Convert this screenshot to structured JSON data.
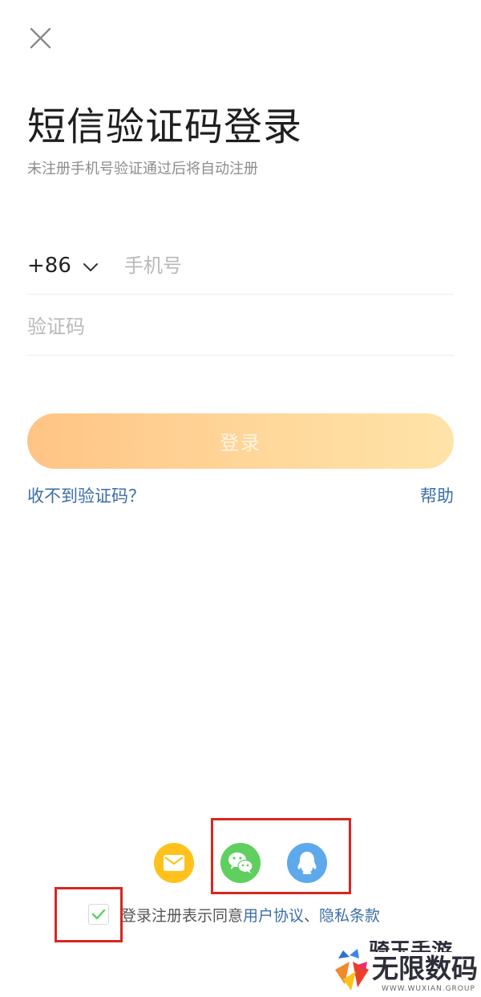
{
  "header": {
    "close_icon": "close-icon",
    "title": "短信验证码登录",
    "subtitle": "未注册手机号验证通过后将自动注册"
  },
  "form": {
    "country_code": "+86",
    "phone_placeholder": "手机号",
    "code_placeholder": "验证码",
    "login_label": "登录"
  },
  "links": {
    "no_code": "收不到验证码？",
    "help": "帮助"
  },
  "social_login": [
    {
      "icon": "email-icon",
      "color": "#ffc21c"
    },
    {
      "icon": "wechat-icon",
      "color": "#5fcf60"
    },
    {
      "icon": "qq-icon",
      "color": "#5ea9ec"
    }
  ],
  "agreement": {
    "checked": true,
    "prefix": "登录注册表示同意",
    "user_agreement": "用户协议",
    "separator": "、",
    "privacy_terms": "隐私条款"
  },
  "watermark": {
    "top_text": "骑玉手游",
    "main_text": "无限数码",
    "sub_text": "WWW.WUXIAN.GROUP"
  },
  "colors": {
    "link": "#3b6ea8",
    "button_gradient_start": "#ffc485",
    "button_gradient_end": "#ffe3a8",
    "highlight_box": "#d9261f",
    "check": "#5fcf60"
  }
}
